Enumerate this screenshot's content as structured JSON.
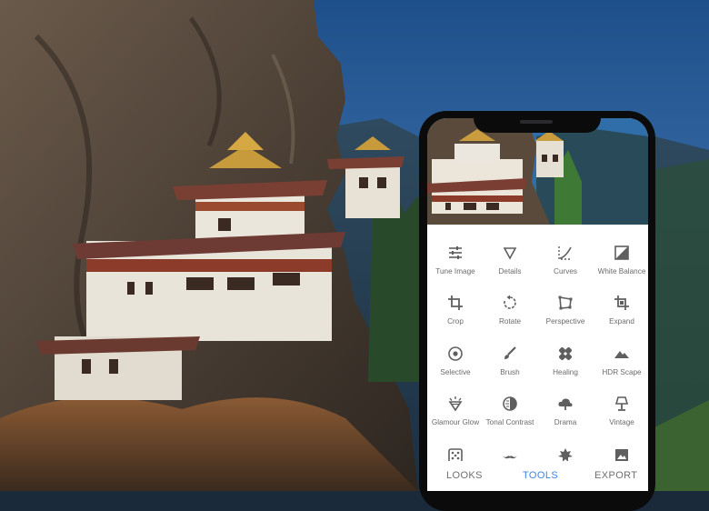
{
  "tools": [
    {
      "label": "Tune Image",
      "icon": "tune-icon"
    },
    {
      "label": "Details",
      "icon": "details-triangle-icon"
    },
    {
      "label": "Curves",
      "icon": "curves-icon"
    },
    {
      "label": "White Balance",
      "icon": "white-balance-icon"
    },
    {
      "label": "Crop",
      "icon": "crop-icon"
    },
    {
      "label": "Rotate",
      "icon": "rotate-icon"
    },
    {
      "label": "Perspective",
      "icon": "perspective-icon"
    },
    {
      "label": "Expand",
      "icon": "expand-icon"
    },
    {
      "label": "Selective",
      "icon": "selective-icon"
    },
    {
      "label": "Brush",
      "icon": "brush-icon"
    },
    {
      "label": "Healing",
      "icon": "healing-bandage-icon"
    },
    {
      "label": "HDR Scape",
      "icon": "hdr-mountain-icon"
    },
    {
      "label": "Glamour Glow",
      "icon": "glamour-glow-icon"
    },
    {
      "label": "Tonal Contrast",
      "icon": "tonal-contrast-icon"
    },
    {
      "label": "Drama",
      "icon": "drama-cloud-icon"
    },
    {
      "label": "Vintage",
      "icon": "vintage-lamp-icon"
    }
  ],
  "nav": {
    "looks": "LOOKS",
    "tools": "TOOLS",
    "export": "EXPORT",
    "active": "TOOLS"
  },
  "colors": {
    "accent": "#3f86e0",
    "icon": "#5f5f5f",
    "label": "#6b6b6b",
    "sky": "#1f4f86"
  }
}
